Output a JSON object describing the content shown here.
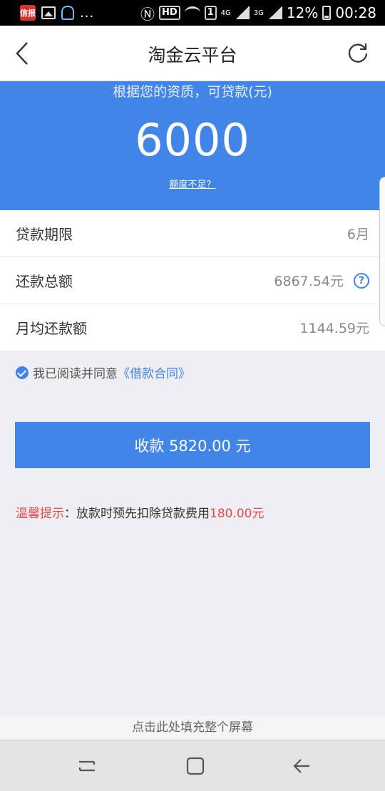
{
  "status_bar": {
    "news_icon_text": "信报",
    "hd_badge": "HD",
    "sim_badge": "1",
    "net_4g": "4G",
    "net_3g": "3G",
    "battery": "12%",
    "time": "00:28"
  },
  "header": {
    "title": "淘金云平台"
  },
  "banner": {
    "subtitle": "根据您的资质，可贷款(元)",
    "amount": "6000",
    "link": "额度不足？",
    "color": "#4285e8"
  },
  "rows": [
    {
      "label": "贷款期限",
      "value": "6月"
    },
    {
      "label": "还款总额",
      "value": "6867.54元",
      "help": "?"
    },
    {
      "label": "月均还款额",
      "value": "1144.59元"
    }
  ],
  "agreement": {
    "text": "我已阅读并同意",
    "link": "《借款合同》"
  },
  "primary_button": {
    "label": "收款 5820.00 元"
  },
  "tip": {
    "prefix": "温馨提示",
    "text": "：放款时预先扣除贷款费用",
    "amount": "180.00元"
  },
  "fill_screen": {
    "label": "点击此处填充整个屏幕"
  }
}
